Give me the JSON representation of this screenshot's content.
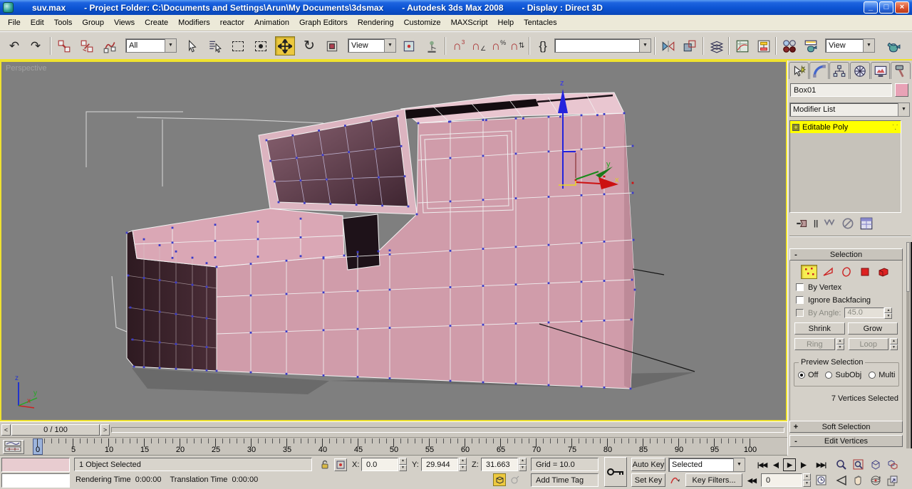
{
  "title_bar": {
    "segments": [
      "suv.max",
      "- Project Folder: C:\\Documents and Settings\\Arun\\My Documents\\3dsmax",
      "- Autodesk 3ds Max 2008",
      "- Display : Direct 3D"
    ],
    "window_buttons": {
      "minimize": "_",
      "maximize": "□",
      "close": "×"
    }
  },
  "menu_bar": {
    "items": [
      "File",
      "Edit",
      "Tools",
      "Group",
      "Views",
      "Create",
      "Modifiers",
      "reactor",
      "Animation",
      "Graph Editors",
      "Rendering",
      "Customize",
      "MAXScript",
      "Help",
      "Tentacles"
    ]
  },
  "toolbar": {
    "selection_filter": "All",
    "coord_system": "View",
    "named_sets_value": "",
    "render_type": "View"
  },
  "viewport": {
    "label": "Perspective",
    "axis": {
      "x": "x",
      "y": "y",
      "z": "z"
    }
  },
  "command_panel": {
    "object_name": "Box01",
    "modifier_list": "Modifier List",
    "stack_items": [
      {
        "label": "Editable Poly"
      }
    ],
    "stack_dots": "˙.˙",
    "selection": {
      "collapse": "-",
      "title": "Selection",
      "by_vertex": "By Vertex",
      "ignore_backfacing": "Ignore Backfacing",
      "by_angle": "By Angle:",
      "by_angle_value": "45.0",
      "shrink": "Shrink",
      "grow": "Grow",
      "ring": "Ring",
      "loop": "Loop",
      "preview": {
        "title": "Preview Selection",
        "off": "Off",
        "subobj": "SubObj",
        "multi": "Multi"
      },
      "status": "7 Vertices Selected"
    },
    "soft_selection": {
      "state": "+",
      "title": "Soft Selection"
    },
    "edit_vertices": {
      "state": "-",
      "title": "Edit Vertices"
    }
  },
  "time": {
    "slider_value": "0 / 100",
    "prev": "<",
    "next": ">",
    "ruler": [
      "0",
      "5",
      "10",
      "15",
      "20",
      "25",
      "30",
      "35",
      "40",
      "45",
      "50",
      "55",
      "60",
      "65",
      "70",
      "75",
      "80",
      "85",
      "90",
      "95",
      "100"
    ]
  },
  "status_bar": {
    "selection_status": "1 Object Selected",
    "prompt": "Rendering Time  0:00:00    Translation Time  0:00:00",
    "labels": {
      "x": "X:",
      "y": "Y:",
      "z": "Z:"
    },
    "coords": {
      "x": "0.0",
      "y": "29.944",
      "z": "31.663"
    },
    "grid": "Grid = 10.0",
    "add_time_tag": "Add Time Tag",
    "auto_key": "Auto Key",
    "set_key": "Set Key",
    "key_filters": "Key Filters...",
    "selected_dropdown": "Selected",
    "frame": "0"
  },
  "transport": {
    "go_start": "|◀◀",
    "prev_frame": "◀|",
    "play": "▶",
    "next_frame": "|▶",
    "go_end": "▶▶|"
  },
  "glyphs": {
    "undo": "↶",
    "redo": "↷",
    "rotate": "↻",
    "named_sets": "{}",
    "layers": "≡",
    "curve_editor": "▦",
    "schematic": "⊞",
    "mirror": "⋈",
    "snap": "∩",
    "snap3": "3",
    "angle": "∠",
    "percent": "%",
    "updown": "⇅",
    "spin_up": "▲",
    "spin_down": "▼",
    "dropdown": "▼",
    "show_end": "||"
  },
  "colors": {
    "accent_yellow": "#efe22f",
    "object_color": "#e8a2b6",
    "stack_highlight": "#ffff00",
    "viewport_bg": "#7f7f7f",
    "model_pink": "#d09caa",
    "model_dark": "#3a232b",
    "vertex": "#3a3ac8",
    "selected_vertex": "#d01010"
  }
}
